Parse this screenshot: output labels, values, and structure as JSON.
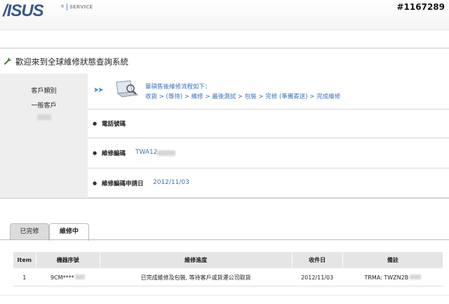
{
  "header": {
    "logo": "/ISUS",
    "logo_reg": "®",
    "service": "SERVICE",
    "watermark": "#1167289"
  },
  "page": {
    "title": "歡迎來到全球維修狀態查詢系統"
  },
  "customer": {
    "type_label": "客戶類別",
    "type_value": "一般客戶"
  },
  "flow": {
    "arrows": "➤➤",
    "title": "華碩售後維修流程如下：",
    "steps": "收貨 > (等待) > 維修 > 最後測試 > 包裝 > 完修 (準備寄送) > 完成維修"
  },
  "fields": {
    "phone_label": "電話號碼",
    "rma_label": "維修編碼",
    "rma_value": "TWA12",
    "date_label": "維修編碼申請日",
    "date_value": "2012/11/03"
  },
  "tabs": {
    "done": "已完修",
    "in_progress": "維修中"
  },
  "table": {
    "headers": [
      "Item",
      "機器序號",
      "維修進度",
      "收件日",
      "備註"
    ],
    "rows": [
      [
        "1",
        "9CM****",
        "已完成維修及包裝, 等待客戶或貨運公司取貨",
        "2012/11/03",
        "TRMA: TWZN2B"
      ]
    ]
  },
  "colors": {
    "logo": "#3a5a8c",
    "link": "#3b72b8",
    "panel_gray": "#eeeeee",
    "table_header": "#e5e5e5"
  }
}
